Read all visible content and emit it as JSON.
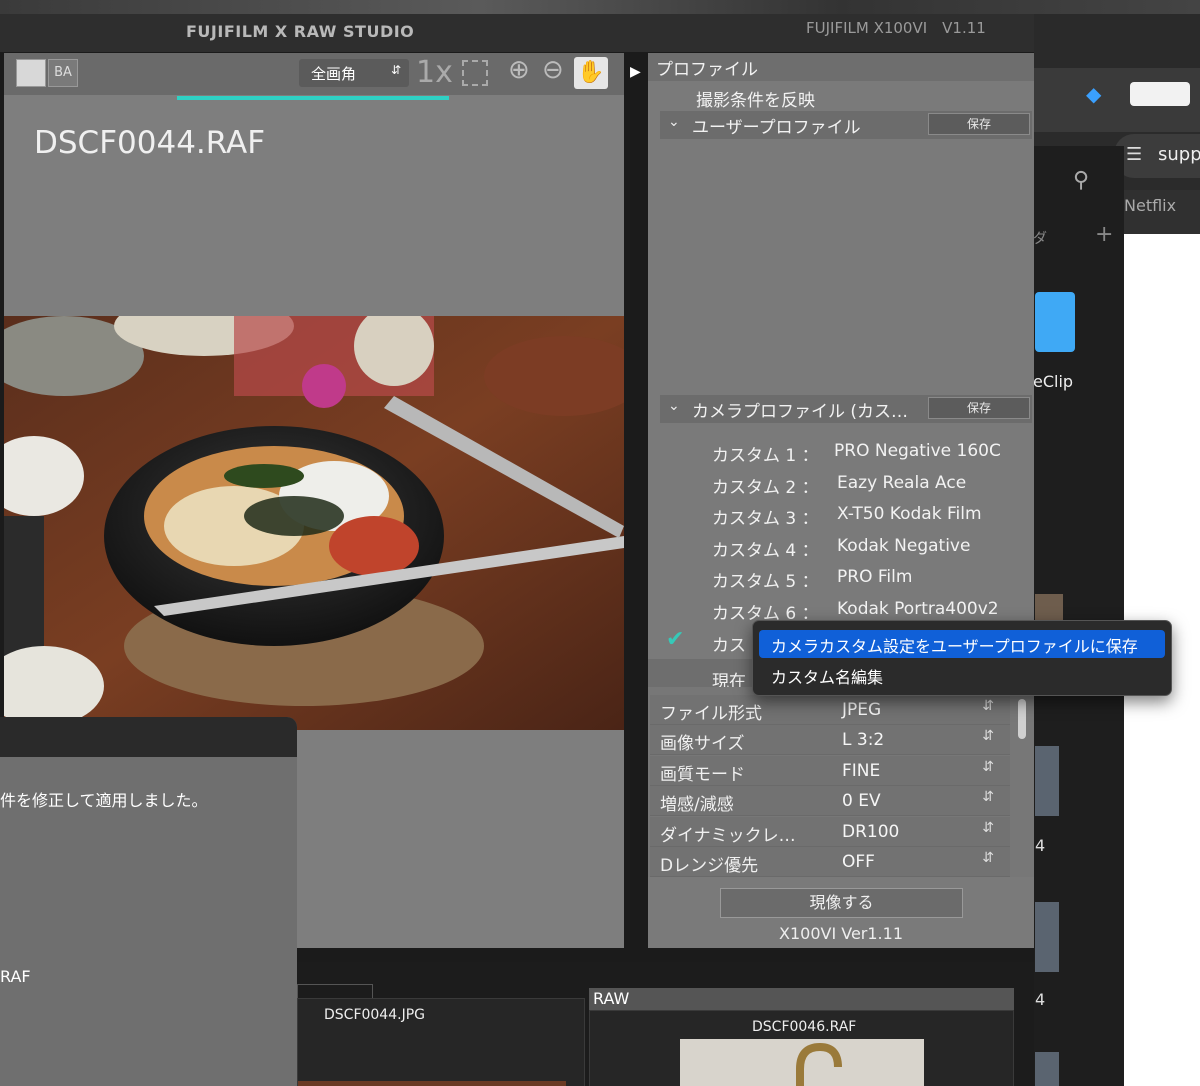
{
  "window": {
    "title": "FUJIFILM X RAW STUDIO",
    "camera_model": "FUJIFILM X100VI　V1.11"
  },
  "toolbar": {
    "compare_b": "B",
    "compare_a": "A",
    "view_select_value": "全画角",
    "zoom_label": "1x"
  },
  "preview": {
    "filename": "DSCF0044.RAF"
  },
  "profile_panel": {
    "header": "プロファイル",
    "apply_conditions": "撮影条件を反映",
    "user_profile_label": "ユーザープロファイル",
    "camera_profile_label": "カメラプロファイル (カス…",
    "save_label": "保存",
    "custom_items": [
      {
        "slot": "カスタム 1 ：",
        "name": "PRO Negative 160C"
      },
      {
        "slot": "カスタム 2 ：",
        "name": "Eazy Reala Ace"
      },
      {
        "slot": "カスタム 3 ：",
        "name": "X-T50 Kodak Film"
      },
      {
        "slot": "カスタム 4 ：",
        "name": "Kodak Negative"
      },
      {
        "slot": "カスタム 5 ：",
        "name": "PRO Film"
      },
      {
        "slot": "カスタム 6 ：",
        "name": "Kodak Portra400v2"
      }
    ],
    "custom_7_partial": "カス",
    "current_partial": "現在"
  },
  "context_menu": {
    "items": [
      "カメラカスタム設定をユーザープロファイルに保存",
      "カスタム名編集"
    ]
  },
  "settings": [
    {
      "label": "ファイル形式",
      "value": "JPEG"
    },
    {
      "label": "画像サイズ",
      "value": "L 3:2"
    },
    {
      "label": "画質モード",
      "value": "FINE"
    },
    {
      "label": "増感/減感",
      "value": "0 EV"
    },
    {
      "label": "ダイナミックレ…",
      "value": "DR100"
    },
    {
      "label": "Dレンジ優先",
      "value": "OFF"
    }
  ],
  "develop_button": "現像する",
  "firmware_version": "X100VI Ver1.11",
  "dialog": {
    "message": "件を修正して適用しました。",
    "file": "RAF"
  },
  "thumbnails": {
    "jpg_name": "DSCF0044.JPG",
    "raw_tag": "RAW",
    "raf_name": "DSCF0046.RAF"
  },
  "background_apps": {
    "browser_search_partial": "supp",
    "browser_tab_partial": "Netflix",
    "finder_item_partial": "eClip",
    "finder_item_2_partial": "4",
    "finder_item_3_partial": "4",
    "finder_tab_partial": "ダ"
  },
  "colors": {
    "accent_cyan": "#2fd1c4",
    "menu_selection": "#1060d8",
    "check_teal": "#36c9b8"
  }
}
